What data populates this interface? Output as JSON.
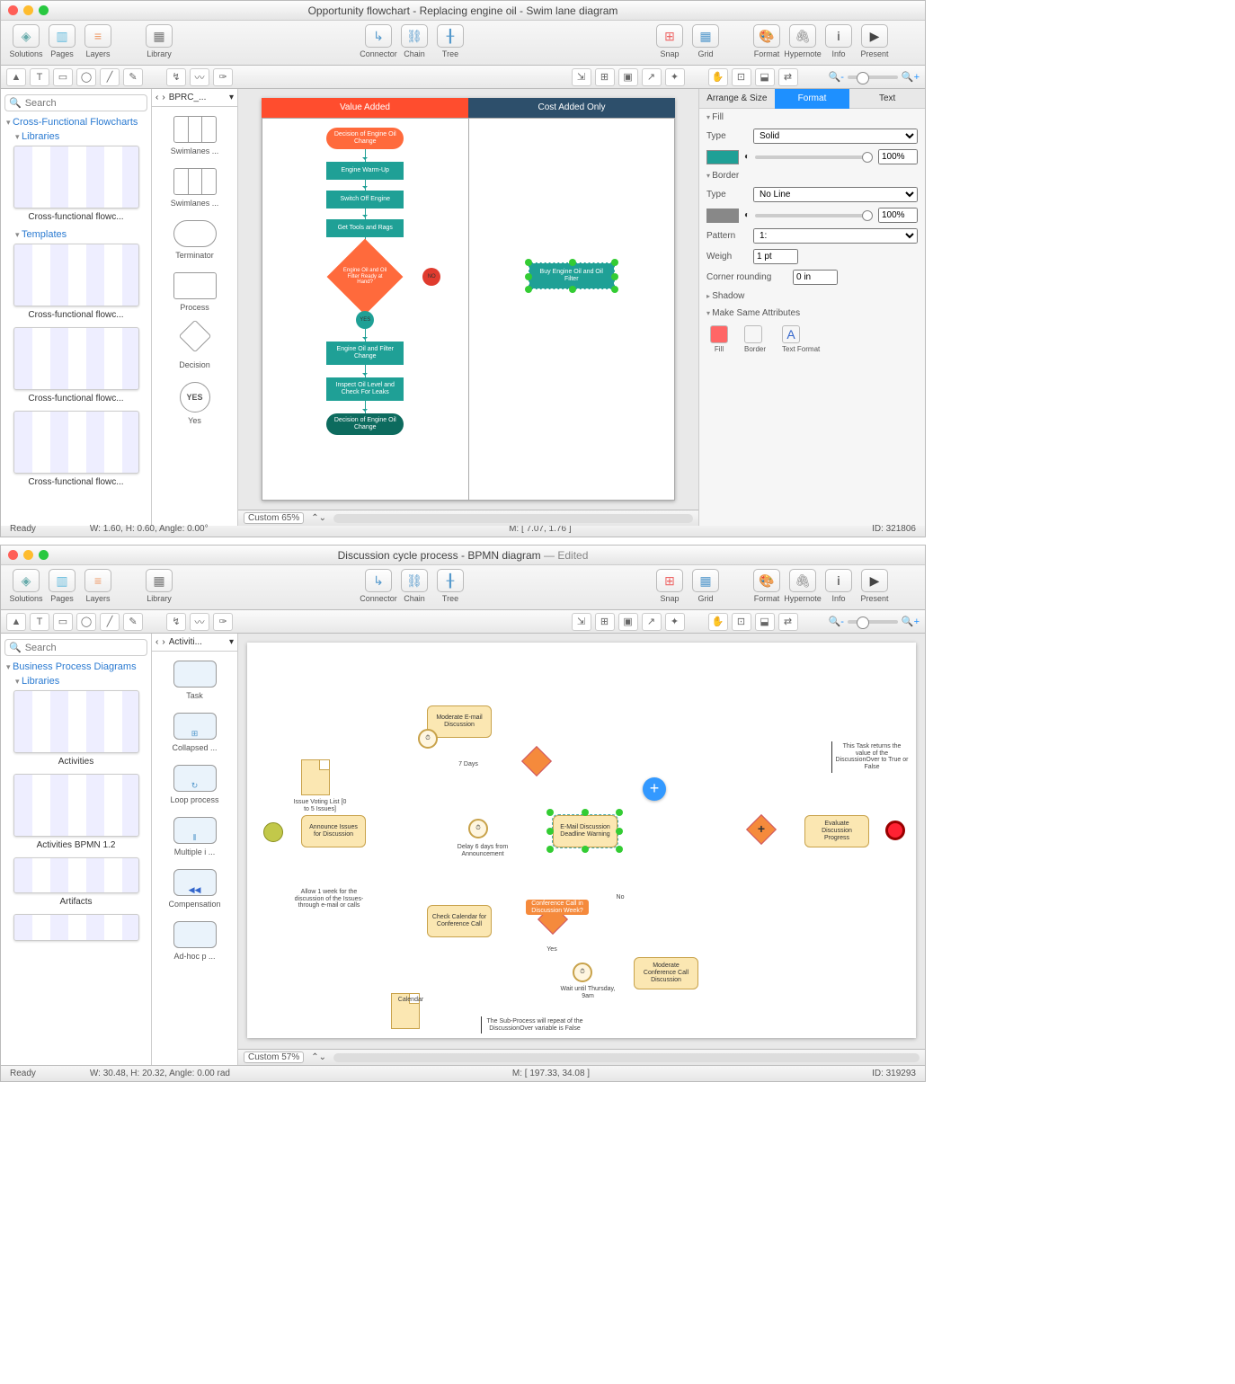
{
  "window1": {
    "title": "Opportunity flowchart - Replacing engine oil - Swim lane diagram",
    "toolbar": [
      "Solutions",
      "Pages",
      "Layers",
      "Library",
      "Connector",
      "Chain",
      "Tree",
      "Snap",
      "Grid",
      "Format",
      "Hypernote",
      "Info",
      "Present"
    ],
    "leftnav": {
      "search_placeholder": "Search",
      "section": "Cross-Functional Flowcharts",
      "sub_lib": "Libraries",
      "lib_caption": "Cross-functional flowc...",
      "sub_tpl": "Templates",
      "tpl_captions": [
        "Cross-functional flowc...",
        "Cross-functional flowc...",
        "Cross-functional flowc..."
      ]
    },
    "stencil": {
      "crumb": "BPRC_...",
      "items": [
        "Swimlanes  ...",
        "Swimlanes  ...",
        "Terminator",
        "Process",
        "Decision",
        "Yes"
      ]
    },
    "canvas": {
      "lanes": [
        "Value Added",
        "Cost Added Only"
      ],
      "shapes": {
        "start": "Decision of Engine Oil Change",
        "p1": "Engine Warm-Up",
        "p2": "Switch Off Engine",
        "p3": "Get Tools and Rags",
        "dec": "Engine Oil and Oil Filter Ready at Hand?",
        "yes": "YES",
        "no": "NO",
        "buy": "Buy Engine Oil and Oil Filter",
        "p4": "Engine Oil and Filter Change",
        "p5": "Inspect Oil Level and Check For Leaks",
        "end": "Decision of Engine Oil Change"
      },
      "zoom_label": "Custom 65%"
    },
    "inspector": {
      "tabs": [
        "Arrange & Size",
        "Format",
        "Text"
      ],
      "fill": {
        "head": "Fill",
        "type_label": "Type",
        "type_value": "Solid",
        "opacity": "100%"
      },
      "border": {
        "head": "Border",
        "type_label": "Type",
        "type_value": "No Line",
        "opacity": "100%",
        "pattern_label": "Pattern",
        "pattern_value": "1:",
        "weigh_label": "Weigh",
        "weigh_value": "1 pt",
        "corner_label": "Corner rounding",
        "corner_value": "0 in"
      },
      "shadow": "Shadow",
      "msa": {
        "head": "Make Same Attributes",
        "items": [
          "Fill",
          "Border",
          "Text Format"
        ]
      }
    },
    "status": {
      "ready": "Ready",
      "dims": "W: 1.60,  H: 0.60,  Angle: 0.00°",
      "mouse": "M: [ 7.07, 1.76 ]",
      "id": "ID: 321806"
    }
  },
  "window2": {
    "title": "Discussion cycle process - BPMN diagram",
    "title_suffix": " — Edited",
    "toolbar": [
      "Solutions",
      "Pages",
      "Layers",
      "Library",
      "Connector",
      "Chain",
      "Tree",
      "Snap",
      "Grid",
      "Format",
      "Hypernote",
      "Info",
      "Present"
    ],
    "leftnav": {
      "search_placeholder": "Search",
      "section": "Business Process Diagrams",
      "sub_lib": "Libraries",
      "captions": [
        "Activities",
        "Activities BPMN 1.2",
        "Artifacts"
      ]
    },
    "stencil": {
      "crumb": "Activiti...",
      "items": [
        "Task",
        "Collapsed  ...",
        "Loop process",
        "Multiple i ...",
        "Compensation",
        "Ad-hoc p ..."
      ]
    },
    "canvas": {
      "shapes": {
        "doc1": "Issue Voting List [0 to 5 Issues]",
        "t_announce": "Announce Issues for Discussion",
        "note_allow": "Allow 1 week for the discussion of the Issues-through e-mail or calls",
        "t_moderate_email": "Moderate E-mail Discussion",
        "lbl_7days": "7 Days",
        "timer_delay": "Delay 6 days from Announcement",
        "t_email_warn": "E-Mail Discussion Deadline Warning",
        "t_check_cal": "Check Calendar for Conference Call",
        "doc2": "Calendar",
        "gw_conf": "Conference Call in Discussion Week?",
        "lbl_yes": "Yes",
        "lbl_no": "No",
        "timer_wait": "Wait until Thursday, 9am",
        "t_moderate_call": "Moderate Conference Call Discussion",
        "t_eval": "Evaluate Discussion Progress",
        "note_return": "This Task returns the value of the DiscussionOver to True or False",
        "note_repeat": "The Sub-Process will repeat of the DiscussionOver variable is False"
      },
      "zoom_label": "Custom 57%"
    },
    "status": {
      "ready": "Ready",
      "dims": "W: 30.48,  H: 20.32,  Angle: 0.00 rad",
      "mouse": "M: [ 197.33, 34.08 ]",
      "id": "ID: 319293"
    }
  }
}
